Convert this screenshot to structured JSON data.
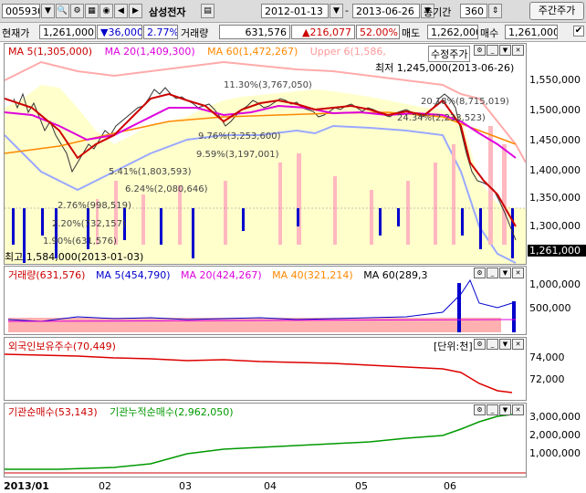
{
  "toolbar": {
    "code": "005930",
    "name": "삼성전자",
    "start_date": "2012-01-13",
    "end_date": "2013-06-26",
    "period_label": "총기간",
    "period": "360",
    "adj_button": "주간주가"
  },
  "quote": {
    "price_label": "현재가",
    "price": "1,261,000",
    "change": "▼36,000",
    "change_pct": "2.77%",
    "volume_label": "거래량",
    "volume": "631,576",
    "vol_change": "▲216,077",
    "vol_ratio": "52.00%",
    "ask_label": "매도",
    "ask": "1,262,000",
    "bid_label": "매수",
    "bid": "1,261,000"
  },
  "price_pane": {
    "legend": {
      "ma5": "MA 5(1,305,000)",
      "ma20": "MA 20(1,409,300)",
      "ma60": "MA 60(1,472,267)",
      "upper": "Upper 6(1,586,",
      "adjusted": "수정주가"
    },
    "low_note": "최저 1,245,000(2013-06-26)",
    "high_note": "최고 1,584,000(2013-01-03)",
    "annotations": [
      "11.30%(3,767,050)",
      "20.18%(8,715,019)",
      "24.34%(2,233,523)",
      "9.76%(3,253,600)",
      "9.59%(3,197,001)",
      "5.41%(1,803,593)",
      "6.24%(2,080,646)",
      "2.76%(998,519)",
      "2.20%(732,157)",
      "1.90%(631,576)"
    ],
    "yticks": [
      "1,550,000",
      "1,500,000",
      "1,450,000",
      "1,400,000",
      "1,350,000",
      "1,300,000"
    ],
    "current_tag": "1,261,000"
  },
  "volume_pane": {
    "legend": {
      "vol": "거래량(631,576)",
      "ma5": "MA 5(454,790)",
      "ma20": "MA 20(424,267)",
      "ma40": "MA 40(321,214)",
      "ma60": "MA 60(289,3"
    },
    "yticks": [
      "1,000,000",
      "500,000"
    ]
  },
  "foreign_pane": {
    "legend": "외국인보유주수(70,449)",
    "unit": "[단위:천]",
    "yticks": [
      "74,000",
      "72,000"
    ]
  },
  "inst_pane": {
    "legend_net": "기관순매수(53,143)",
    "legend_cum": "기관누적순매수(2,962,050)",
    "yticks": [
      "3,000,000",
      "2,000,000",
      "1,000,000"
    ]
  },
  "xaxis": [
    "2013/01",
    "02",
    "03",
    "04",
    "05",
    "06"
  ],
  "colors": {
    "up": "#ff2222",
    "down": "#0000cc",
    "ma5": "#cc0000",
    "ma20": "#dd00dd",
    "ma60": "#ff8800",
    "band": "#ffaaaa",
    "cloud": "#ffffcc",
    "foreign": "#dd0000",
    "cum": "#009900"
  }
}
